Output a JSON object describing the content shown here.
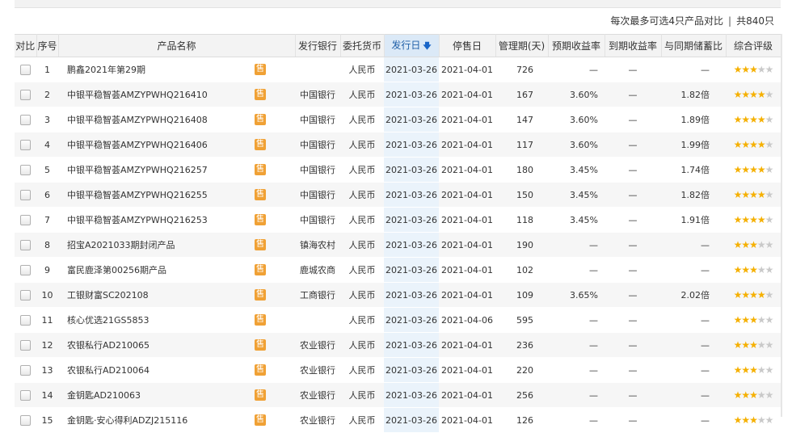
{
  "summary": {
    "compare_hint": "每次最多可选4只产品对比",
    "separator": "|",
    "total": "共840只"
  },
  "columns": {
    "compare": "对比",
    "index": "序号",
    "name": "产品名称",
    "bank": "发行银行",
    "currency": "委托货币",
    "issue_date": "发行日",
    "stop_date": "停售日",
    "period": "管理期(天)",
    "expected_rate": "预期收益率",
    "actual_rate": "到期收益率",
    "deposit_ratio": "与同期储蓄比",
    "rating": "综合评级"
  },
  "sort": {
    "column": "issue_date",
    "direction": "desc",
    "icon": "sort-down-arrow-icon"
  },
  "sell_badge": "售",
  "colors": {
    "sell_badge": "#f0a135",
    "sorted_header": "#dbe9f7",
    "star_on": "#f5b000",
    "star_off": "#c9c9c9"
  },
  "rows": [
    {
      "index": "1",
      "name": "鹏鑫2021年第29期",
      "bank": "",
      "currency": "人民币",
      "issue_date": "2021-03-26",
      "stop_date": "2021-04-01",
      "period": "726",
      "expected_rate": "—",
      "actual_rate": "—",
      "deposit_ratio": "—",
      "stars": 3
    },
    {
      "index": "2",
      "name": "中银平稳智荟AMZYPWHQ216410",
      "bank": "中国银行",
      "currency": "人民币",
      "issue_date": "2021-03-26",
      "stop_date": "2021-04-01",
      "period": "167",
      "expected_rate": "3.60%",
      "actual_rate": "—",
      "deposit_ratio": "1.82倍",
      "stars": 4
    },
    {
      "index": "3",
      "name": "中银平稳智荟AMZYPWHQ216408",
      "bank": "中国银行",
      "currency": "人民币",
      "issue_date": "2021-03-26",
      "stop_date": "2021-04-01",
      "period": "147",
      "expected_rate": "3.60%",
      "actual_rate": "—",
      "deposit_ratio": "1.89倍",
      "stars": 4
    },
    {
      "index": "4",
      "name": "中银平稳智荟AMZYPWHQ216406",
      "bank": "中国银行",
      "currency": "人民币",
      "issue_date": "2021-03-26",
      "stop_date": "2021-04-01",
      "period": "117",
      "expected_rate": "3.60%",
      "actual_rate": "—",
      "deposit_ratio": "1.99倍",
      "stars": 4
    },
    {
      "index": "5",
      "name": "中银平稳智荟AMZYPWHQ216257",
      "bank": "中国银行",
      "currency": "人民币",
      "issue_date": "2021-03-26",
      "stop_date": "2021-04-01",
      "period": "180",
      "expected_rate": "3.45%",
      "actual_rate": "—",
      "deposit_ratio": "1.74倍",
      "stars": 4
    },
    {
      "index": "6",
      "name": "中银平稳智荟AMZYPWHQ216255",
      "bank": "中国银行",
      "currency": "人民币",
      "issue_date": "2021-03-26",
      "stop_date": "2021-04-01",
      "period": "150",
      "expected_rate": "3.45%",
      "actual_rate": "—",
      "deposit_ratio": "1.82倍",
      "stars": 4
    },
    {
      "index": "7",
      "name": "中银平稳智荟AMZYPWHQ216253",
      "bank": "中国银行",
      "currency": "人民币",
      "issue_date": "2021-03-26",
      "stop_date": "2021-04-01",
      "period": "118",
      "expected_rate": "3.45%",
      "actual_rate": "—",
      "deposit_ratio": "1.91倍",
      "stars": 4
    },
    {
      "index": "8",
      "name": "招宝A2021033期封闭产品",
      "bank": "镇海农村",
      "currency": "人民币",
      "issue_date": "2021-03-26",
      "stop_date": "2021-04-01",
      "period": "190",
      "expected_rate": "—",
      "actual_rate": "—",
      "deposit_ratio": "—",
      "stars": 3
    },
    {
      "index": "9",
      "name": "富民鹿泽第00256期产品",
      "bank": "鹿城农商",
      "currency": "人民币",
      "issue_date": "2021-03-26",
      "stop_date": "2021-04-01",
      "period": "102",
      "expected_rate": "—",
      "actual_rate": "—",
      "deposit_ratio": "—",
      "stars": 3
    },
    {
      "index": "10",
      "name": "工银财富SC202108",
      "bank": "工商银行",
      "currency": "人民币",
      "issue_date": "2021-03-26",
      "stop_date": "2021-04-01",
      "period": "109",
      "expected_rate": "3.65%",
      "actual_rate": "—",
      "deposit_ratio": "2.02倍",
      "stars": 4
    },
    {
      "index": "11",
      "name": "核心优选21GS5853",
      "bank": "",
      "currency": "人民币",
      "issue_date": "2021-03-26",
      "stop_date": "2021-04-06",
      "period": "595",
      "expected_rate": "—",
      "actual_rate": "—",
      "deposit_ratio": "—",
      "stars": 3
    },
    {
      "index": "12",
      "name": "农银私行AD210065",
      "bank": "农业银行",
      "currency": "人民币",
      "issue_date": "2021-03-26",
      "stop_date": "2021-04-01",
      "period": "236",
      "expected_rate": "—",
      "actual_rate": "—",
      "deposit_ratio": "—",
      "stars": 3
    },
    {
      "index": "13",
      "name": "农银私行AD210064",
      "bank": "农业银行",
      "currency": "人民币",
      "issue_date": "2021-03-26",
      "stop_date": "2021-04-01",
      "period": "220",
      "expected_rate": "—",
      "actual_rate": "—",
      "deposit_ratio": "—",
      "stars": 3
    },
    {
      "index": "14",
      "name": "金钥匙AD210063",
      "bank": "农业银行",
      "currency": "人民币",
      "issue_date": "2021-03-26",
      "stop_date": "2021-04-01",
      "period": "256",
      "expected_rate": "—",
      "actual_rate": "—",
      "deposit_ratio": "—",
      "stars": 3
    },
    {
      "index": "15",
      "name": "金钥匙·安心得利ADZJ215116",
      "bank": "农业银行",
      "currency": "人民币",
      "issue_date": "2021-03-26",
      "stop_date": "2021-04-01",
      "period": "126",
      "expected_rate": "—",
      "actual_rate": "—",
      "deposit_ratio": "—",
      "stars": 3
    }
  ]
}
